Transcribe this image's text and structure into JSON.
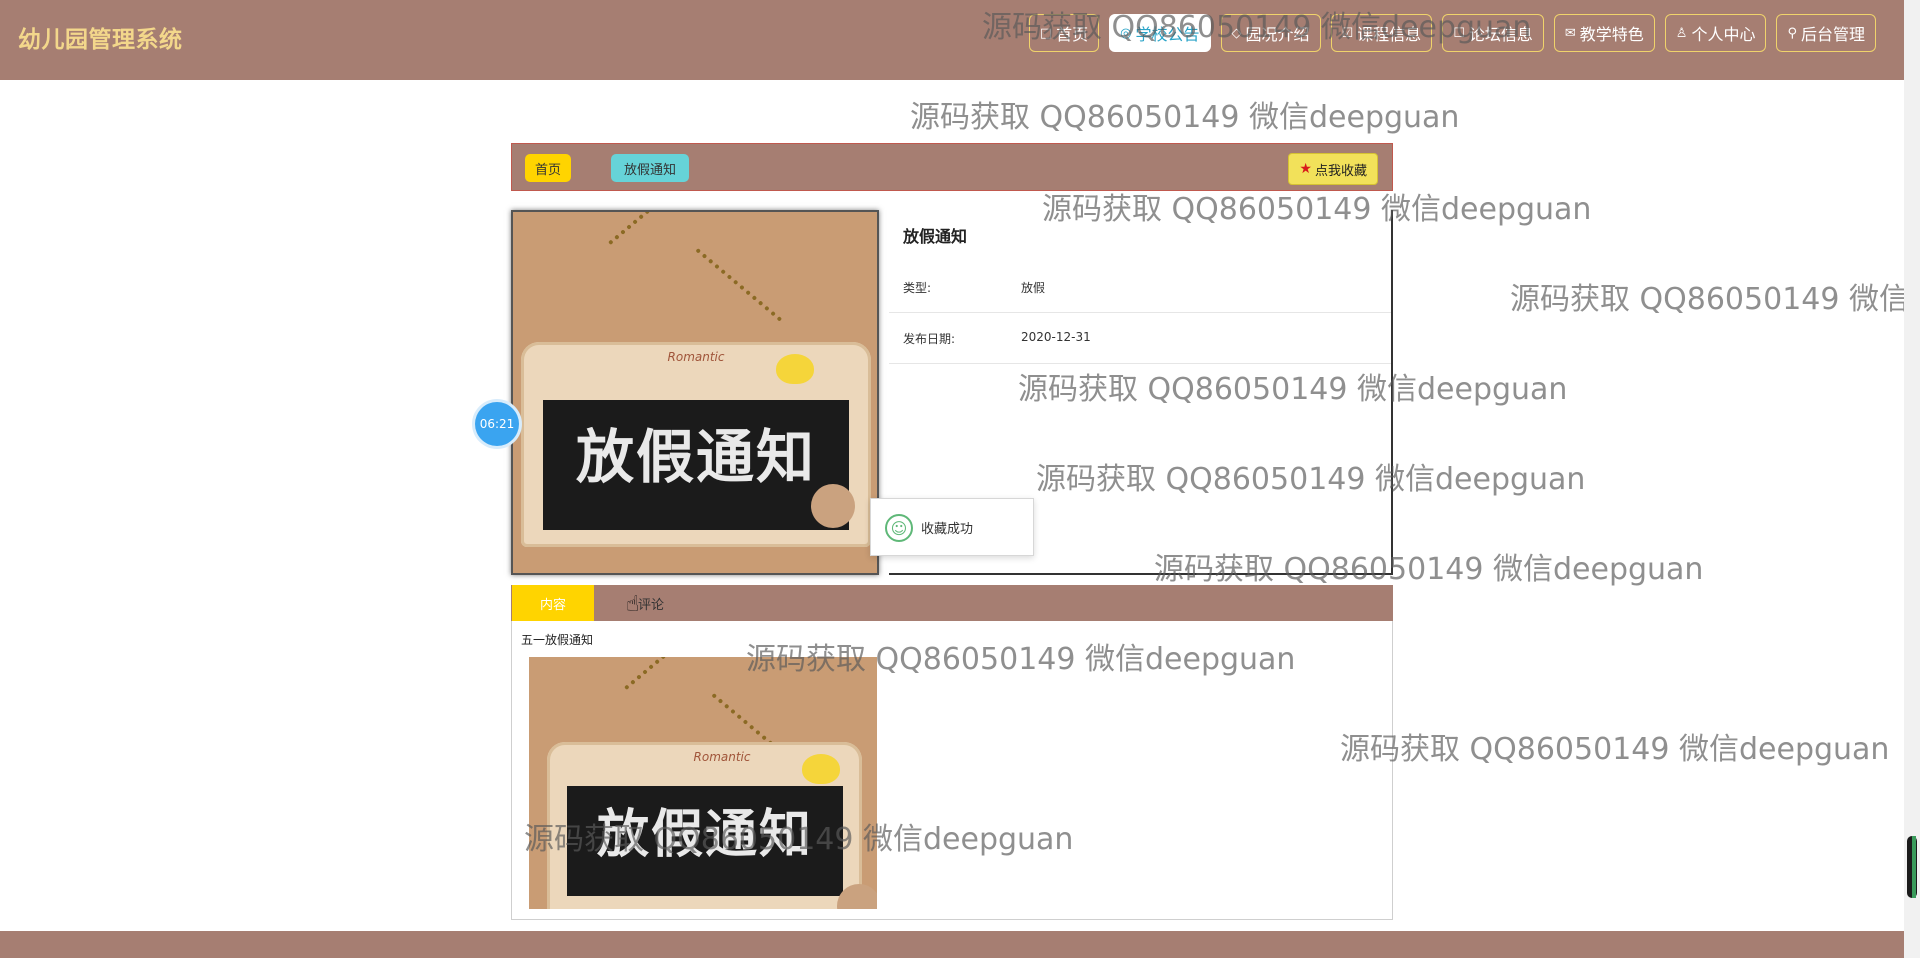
{
  "brand": "幼儿园管理系统",
  "nav": [
    {
      "icon": "□",
      "label": "首页"
    },
    {
      "icon": "◎",
      "label": "学校公告"
    },
    {
      "icon": "◇",
      "label": "园况介绍"
    },
    {
      "icon": "☑",
      "label": "课程信息"
    },
    {
      "icon": "☐",
      "label": "论坛信息"
    },
    {
      "icon": "✉",
      "label": "教学特色"
    },
    {
      "icon": "♙",
      "label": "个人中心"
    },
    {
      "icon": "⚲",
      "label": "后台管理"
    }
  ],
  "breadcrumb": {
    "home": "首页",
    "current": "放假通知"
  },
  "favorite_button": {
    "icon": "★",
    "label": "点我收藏"
  },
  "image_text": "放假通知",
  "frame_logo": "Romantic",
  "detail": {
    "title": "放假通知",
    "type_label": "类型:",
    "type_value": "放假",
    "date_label": "发布日期:",
    "date_value": "2020-12-31"
  },
  "timer": "06:21",
  "toast": {
    "icon": "☺",
    "text": "收藏成功"
  },
  "tabs": {
    "content": "内容",
    "comment": "评论"
  },
  "content": {
    "text": "五一放假通知"
  },
  "watermark": "源码获取 QQ86050149 微信deepguan"
}
